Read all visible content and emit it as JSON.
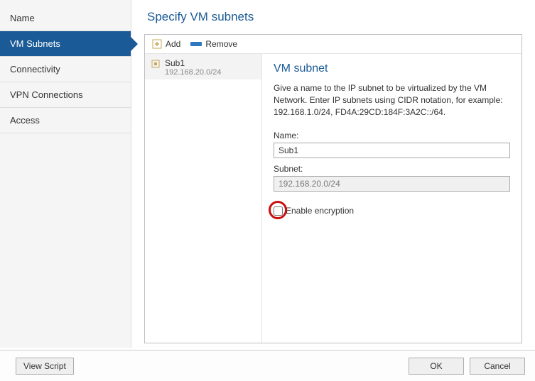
{
  "sidebar": {
    "items": [
      {
        "label": "Name",
        "selected": false
      },
      {
        "label": "VM Subnets",
        "selected": true
      },
      {
        "label": "Connectivity",
        "selected": false
      },
      {
        "label": "VPN Connections",
        "selected": false
      },
      {
        "label": "Access",
        "selected": false
      }
    ]
  },
  "page_title": "Specify VM subnets",
  "toolbar": {
    "add_label": "Add",
    "remove_label": "Remove"
  },
  "subnet_list": [
    {
      "name": "Sub1",
      "cidr": "192.168.20.0/24"
    }
  ],
  "detail": {
    "title": "VM subnet",
    "help": "Give a name to the IP subnet to be virtualized by the VM Network. Enter IP subnets using CIDR notation, for example: 192.168.1.0/24, FD4A:29CD:184F:3A2C::/64.",
    "name_label": "Name:",
    "name_value": "Sub1",
    "subnet_label": "Subnet:",
    "subnet_value": "192.168.20.0/24",
    "encryption_label": "Enable encryption",
    "encryption_checked": false
  },
  "footer": {
    "view_script": "View Script",
    "ok": "OK",
    "cancel": "Cancel"
  }
}
